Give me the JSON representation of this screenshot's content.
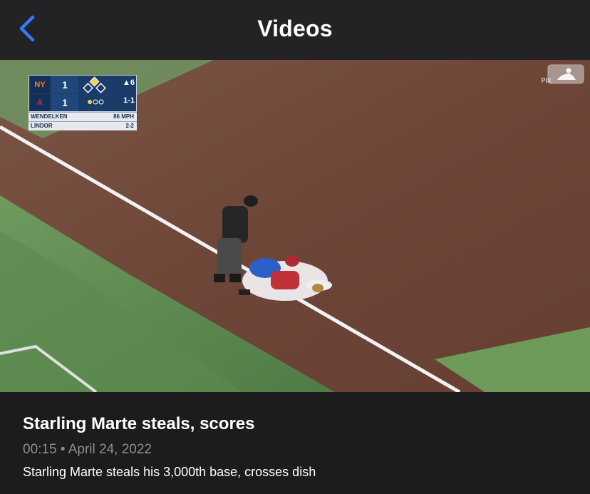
{
  "nav": {
    "title": "Videos",
    "back_icon": "chevron-left-icon",
    "accent_color": "#2f7df6"
  },
  "video": {
    "scorebug": {
      "away_team": "NY",
      "home_team": "A",
      "away_score": "1",
      "home_score": "1",
      "inning": "▲6",
      "count": "1-1",
      "pitcher": "WENDELKEN",
      "pitch_speed": "86 MPH",
      "batter": "LINDOR",
      "batter_stat": "2-2"
    },
    "broadcaster": "PIX",
    "logo_icon": "mlb-logo-icon"
  },
  "info": {
    "title": "Starling Marte steals, scores",
    "duration": "00:15",
    "separator": "•",
    "date": "April 24, 2022",
    "description": "Starling Marte steals his 3,000th base, crosses dish"
  }
}
